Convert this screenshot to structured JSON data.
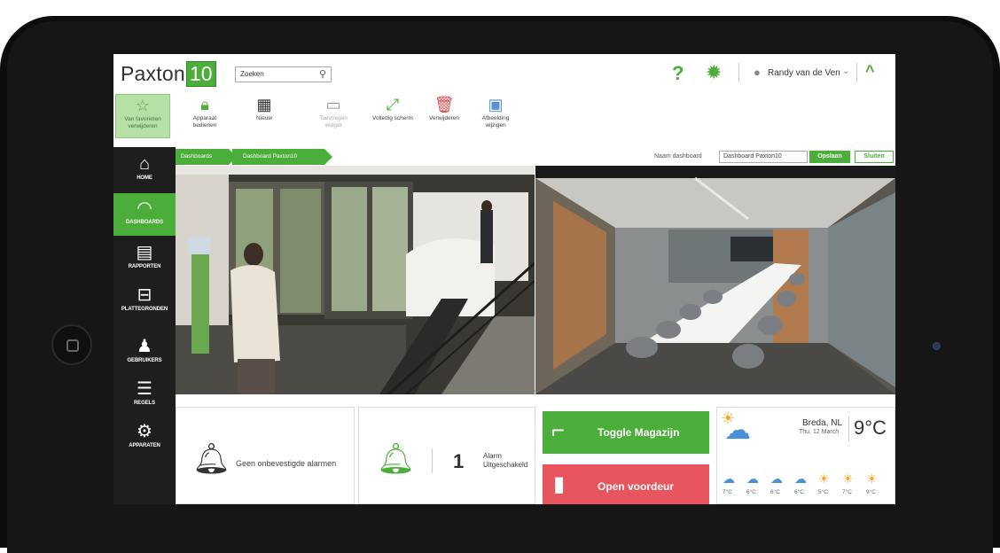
{
  "header": {
    "logo_text": "Paxton",
    "logo_version": "10",
    "search_placeholder": "Zoeken",
    "help_icon": "?",
    "user_name": "Randy van de Ven"
  },
  "ribbon": {
    "buttons": [
      {
        "label": "Van favorieten verwijderen",
        "icon": "star-icon"
      },
      {
        "label": "Apparaat bedienen",
        "icon": "lock-icon"
      },
      {
        "label": "Nieuw",
        "icon": "grid-plus-icon"
      },
      {
        "label": "Toevoegen widget",
        "icon": "add-widget-icon"
      },
      {
        "label": "Volledig scherm",
        "icon": "fullscreen-icon"
      },
      {
        "label": "Verwijderen",
        "icon": "trash-icon"
      },
      {
        "label": "Afbeelding wijzigen",
        "icon": "image-icon"
      }
    ]
  },
  "sidebar": {
    "items": [
      {
        "label": "HOME",
        "icon": "home-icon"
      },
      {
        "label": "DASHBOARDS",
        "icon": "gauge-icon"
      },
      {
        "label": "RAPPORTEN",
        "icon": "report-icon"
      },
      {
        "label": "PLATTEGRONDEN",
        "icon": "floorplan-icon"
      },
      {
        "label": "GEBRUIKERS",
        "icon": "user-icon"
      },
      {
        "label": "REGELS",
        "icon": "rules-icon"
      },
      {
        "label": "APPARATEN",
        "icon": "devices-icon"
      }
    ]
  },
  "breadcrumb": {
    "items": [
      "Dashboards",
      "Dashboard Paxton10"
    ],
    "name_label": "Naam dashboard",
    "name_value": "Dashboard Paxton10",
    "save_label": "Opslaan",
    "close_label": "Sluiten"
  },
  "widgets": {
    "alarms_text": "Geen onbevestigde alarmen",
    "alarm_count": "1",
    "alarm_line1": "Alarm",
    "alarm_line2": "Uitgeschakeld",
    "toggle_label": "Toggle Magazijn",
    "open_label": "Open voordeur",
    "weather": {
      "location": "Breda, NL",
      "date": "Thu, 12 March",
      "temp": "9°C",
      "forecast": [
        "7°C",
        "6°C",
        "6°C",
        "6°C",
        "5°C",
        "7°C",
        "9°C"
      ]
    }
  },
  "colors": {
    "accent": "#4cae3a",
    "danger": "#e8555f",
    "sidebar_bg": "#1e1e1e"
  }
}
